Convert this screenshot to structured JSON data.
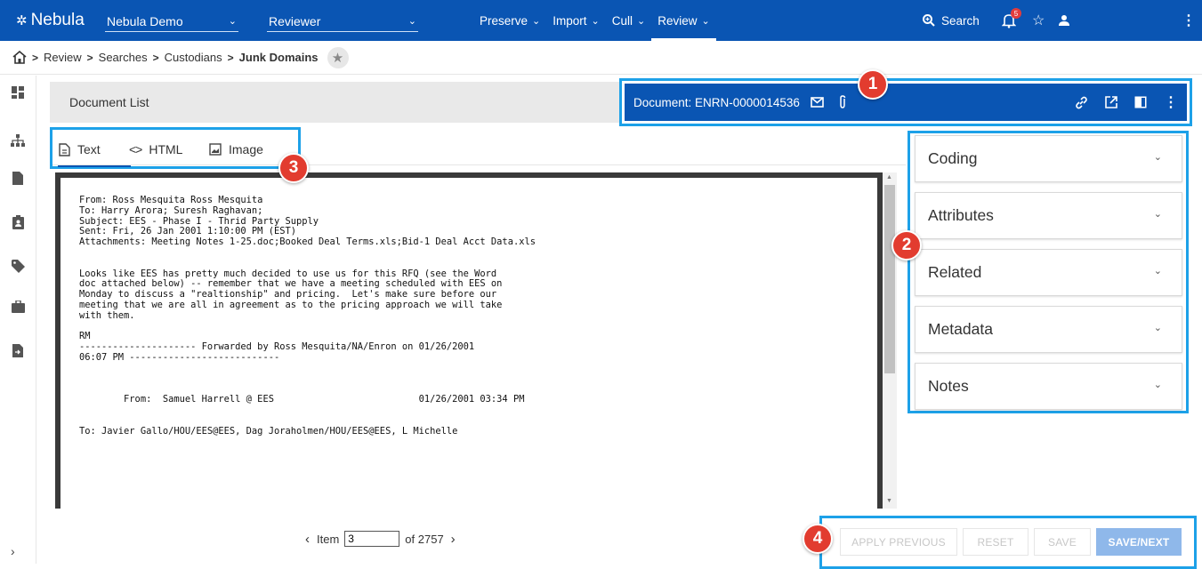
{
  "app": {
    "logo_text": "Nebula",
    "project_select": "Nebula Demo",
    "role_select": "Reviewer",
    "nav": [
      {
        "label": "Preserve"
      },
      {
        "label": "Import"
      },
      {
        "label": "Cull"
      },
      {
        "label": "Review"
      }
    ],
    "active_nav": "Review",
    "search_label": "Search",
    "notification_count": "5",
    "accent_color": "#0a55b3",
    "highlight_color": "#1da1e8"
  },
  "breadcrumb": {
    "items": [
      "Review",
      "Searches",
      "Custodians"
    ],
    "current": "Junk Domains"
  },
  "document_list": {
    "label": "Document List"
  },
  "document_header": {
    "title": "Document: ENRN-0000014536"
  },
  "tabs": [
    {
      "label": "Text",
      "icon": "text-doc-icon"
    },
    {
      "label": "HTML",
      "icon": "code-icon"
    },
    {
      "label": "Image",
      "icon": "image-icon"
    }
  ],
  "document_text": "From: Ross Mesquita Ross Mesquita\nTo: Harry Arora; Suresh Raghavan;\nSubject: EES - Phase I - Thrid Party Supply\nSent: Fri, 26 Jan 2001 1:10:00 PM (EST)\nAttachments: Meeting Notes 1-25.doc;Booked Deal Terms.xls;Bid-1 Deal Acct Data.xls\n\n\nLooks like EES has pretty much decided to use us for this RFQ (see the Word\ndoc attached below) -- remember that we have a meeting scheduled with EES on\nMonday to discuss a \"realtionship\" and pricing.  Let's make sure before our\nmeeting that we are all in agreement as to the pricing approach we will take\nwith them.\n\nRM\n--------------------- Forwarded by Ross Mesquita/NA/Enron on 01/26/2001\n06:07 PM ---------------------------\n\n\n\n        From:  Samuel Harrell @ EES                          01/26/2001 03:34 PM\n\n\nTo: Javier Gallo/HOU/EES@EES, Dag Joraholmen/HOU/EES@EES, L Michelle",
  "pager": {
    "prefix": "Item",
    "current": "3",
    "total_text": "of 2757"
  },
  "panels": [
    {
      "label": "Coding"
    },
    {
      "label": "Attributes"
    },
    {
      "label": "Related"
    },
    {
      "label": "Metadata"
    },
    {
      "label": "Notes"
    }
  ],
  "actions": {
    "apply_previous": "APPLY PREVIOUS",
    "reset": "RESET",
    "save": "SAVE",
    "save_next": "SAVE/NEXT"
  },
  "markers": [
    "1",
    "2",
    "3",
    "4"
  ]
}
